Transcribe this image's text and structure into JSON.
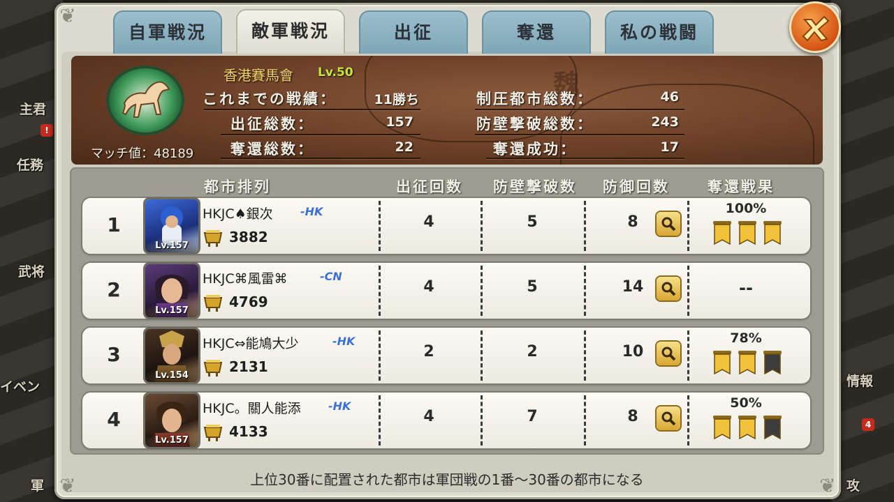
{
  "tabs": [
    {
      "label": "自軍戦況",
      "active": false
    },
    {
      "label": "敵軍戦況",
      "active": true
    },
    {
      "label": "出征",
      "active": false
    },
    {
      "label": "奪還",
      "active": false
    },
    {
      "label": "私の戦闘",
      "active": false
    }
  ],
  "background": {
    "left_labels": [
      "主君",
      "任務",
      "武将",
      "イベン",
      "軍"
    ],
    "left_badge": "!",
    "right_labels": [
      "情報",
      "攻"
    ],
    "right_badge": "4"
  },
  "clan": {
    "name": "香港賽馬會",
    "level": "Lv.50",
    "match_value": "マッチ値：48189"
  },
  "stats": {
    "record_label": "これまでの戦績：",
    "record_value": "11勝ち",
    "sorties_label": "出征総数：",
    "sorties_value": "157",
    "recaptures_label": "奪還総数：",
    "recaptures_value": "22",
    "cities_label": "制圧都市総数：",
    "cities_value": "46",
    "walls_label": "防壁撃破総数：",
    "walls_value": "243",
    "recapture_success_label": "奪還成功：",
    "recapture_success_value": "17"
  },
  "table": {
    "headers": [
      "都市排列",
      "出征回数",
      "防壁撃破数",
      "防御回数",
      "奪還戦果"
    ],
    "rows": [
      {
        "rank": "1",
        "name": "HKJC♠銀次",
        "tag": "-HK",
        "level": "Lv.157",
        "power": "3882",
        "sorties": "4",
        "walls": "5",
        "defenses": "8",
        "result": "100%",
        "flags": [
          true,
          true,
          true
        ]
      },
      {
        "rank": "2",
        "name": "HKJC⌘風雷⌘",
        "tag": "-CN",
        "level": "Lv.157",
        "power": "4769",
        "sorties": "4",
        "walls": "5",
        "defenses": "14",
        "result": "--",
        "flags": []
      },
      {
        "rank": "3",
        "name": "HKJC⇔能鳩大少",
        "tag": "-HK",
        "level": "Lv.154",
        "power": "2131",
        "sorties": "2",
        "walls": "2",
        "defenses": "10",
        "result": "78%",
        "flags": [
          true,
          true,
          false
        ]
      },
      {
        "rank": "4",
        "name": "HKJC。關人能添",
        "tag": "-HK",
        "level": "Lv.157",
        "power": "4133",
        "sorties": "4",
        "walls": "7",
        "defenses": "8",
        "result": "50%",
        "flags": [
          true,
          true,
          false
        ]
      }
    ]
  },
  "footer": "上位30番に配置された都市は軍団戦の1番～30番の都市になる",
  "colors": {
    "gold_flag": "#f2c23a",
    "dark_flag": "#3c3c3c",
    "tag_blue": "#3b6fd6",
    "clan_name": "#f5d36a",
    "clan_level": "#c8e639"
  }
}
